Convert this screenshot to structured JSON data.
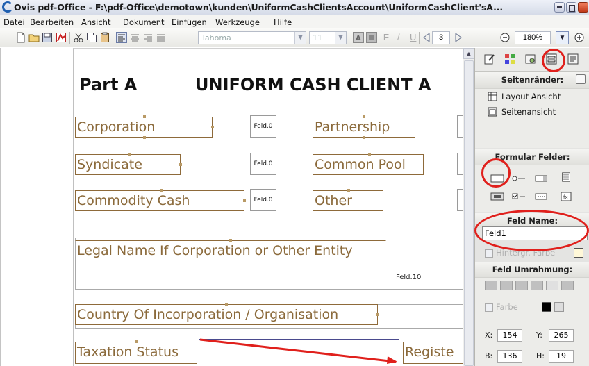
{
  "window": {
    "title": "Ovis pdf-Office - F:\\pdf-Office\\demotown\\kunden\\UniformCashClientsAccount\\UniformCashClient'sA..."
  },
  "menu": [
    "Datei",
    "Bearbeiten",
    "Ansicht",
    "Dokument",
    "Einfügen",
    "Werkzeuge",
    "Hilfe"
  ],
  "toolbar": {
    "font_name": "Tahoma",
    "font_size": "11",
    "bold_label": "F",
    "italic_label": "/",
    "underline_label": "U",
    "page_number": "3",
    "zoom": "180%"
  },
  "document": {
    "heading_part": "Part A",
    "heading_title": "UNIFORM CASH CLIENT A",
    "labels": {
      "corporation": "Corporation",
      "partnership": "Partnership",
      "syndicate": "Syndicate",
      "common_pool": "Common Pool",
      "commodity_cash": "Commodity Cash",
      "other": "Other",
      "legal_name": "Legal Name If Corporation or Other Entity",
      "country": "Country Of Incorporation / Organisation",
      "taxation": "Taxation Status",
      "register": "Registe"
    },
    "fields": {
      "corporation_field": "Feld.0",
      "syndicate_field": "Feld.0",
      "commodity_field": "Feld.0",
      "legal_name_field": "Feld.10"
    },
    "annotation_color": "#e0201c"
  },
  "panel": {
    "margins_header": "Seitenränder:",
    "layout_view": "Layout Ansicht",
    "page_view": "Seitenansicht",
    "form_fields_header": "Formular Felder:",
    "field_name_header": "Feld Name:",
    "field_name_value": "Feld1",
    "background_color_label": "Hintergr. Farbe",
    "field_border_header": "Feld Umrahmung:",
    "color_label": "Farbe",
    "x_label": "X:",
    "x_value": "154",
    "y_label": "Y:",
    "y_value": "265",
    "b_label": "B:",
    "b_value": "136",
    "h_label": "H:",
    "h_value": "19"
  }
}
